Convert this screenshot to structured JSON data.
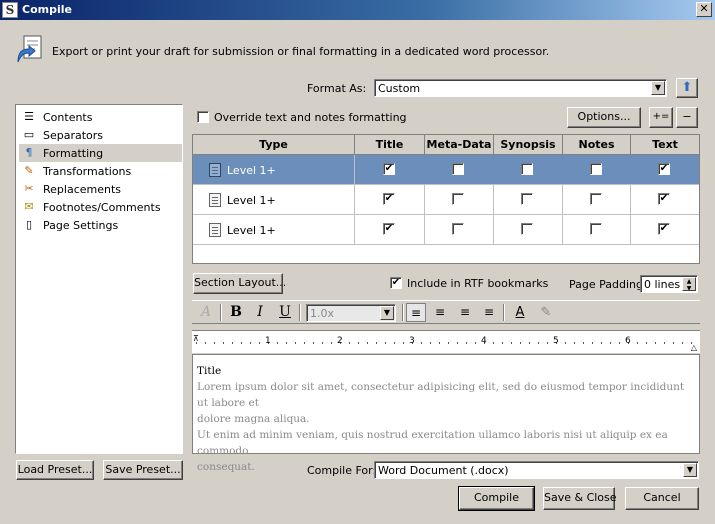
{
  "window": {
    "title": "Compile",
    "app_icon": "S"
  },
  "header": {
    "description": "Export or print your draft for submission or final formatting in a dedicated word processor."
  },
  "format_as": {
    "label": "Format As:",
    "value": "Custom"
  },
  "sidebar": {
    "items": [
      {
        "label": "Contents",
        "icon": "list-icon",
        "selected": false
      },
      {
        "label": "Separators",
        "icon": "separator-icon",
        "selected": false
      },
      {
        "label": "Formatting",
        "icon": "formatting-icon",
        "selected": true
      },
      {
        "label": "Transformations",
        "icon": "transform-icon",
        "selected": false
      },
      {
        "label": "Replacements",
        "icon": "replace-icon",
        "selected": false
      },
      {
        "label": "Footnotes/Comments",
        "icon": "footnote-icon",
        "selected": false
      },
      {
        "label": "Page Settings",
        "icon": "page-icon",
        "selected": false
      }
    ]
  },
  "formatting": {
    "override_label": "Override text and notes formatting",
    "override_checked": false,
    "options_label": "Options...",
    "add_label": "+=",
    "remove_label": "−",
    "columns": [
      "Type",
      "Title",
      "Meta-Data",
      "Synopsis",
      "Notes",
      "Text"
    ],
    "rows": [
      {
        "type": "Level 1+",
        "icon": "folder-icon",
        "selected": true,
        "title": true,
        "meta": false,
        "synopsis": false,
        "notes": false,
        "text": true
      },
      {
        "type": "Level 1+",
        "icon": "document-group-icon",
        "selected": false,
        "title": true,
        "meta": false,
        "synopsis": false,
        "notes": false,
        "text": true
      },
      {
        "type": "Level 1+",
        "icon": "document-icon",
        "selected": false,
        "title": true,
        "meta": false,
        "synopsis": false,
        "notes": false,
        "text": true
      }
    ],
    "section_layout_label": "Section Layout...",
    "rtf_bookmarks_label": "Include in RTF bookmarks",
    "rtf_bookmarks_checked": true,
    "page_padding_label": "Page Padding:",
    "page_padding_value": "0 lines",
    "line_spacing": "1.0x",
    "ruler_numbers": [
      "1",
      "2",
      "3",
      "4",
      "5",
      "6"
    ],
    "preview_title": "Title",
    "preview_body_1": "Lorem ipsum dolor sit amet, consectetur adipisicing elit, sed do eiusmod tempor incididunt ut labore et",
    "preview_body_2": "dolore magna aliqua.",
    "preview_body_3": "Ut enim ad minim veniam, quis nostrud exercitation ullamco laboris nisi ut aliquip ex ea commodo",
    "preview_body_4": "consequat."
  },
  "toolbar": {
    "font_icon": "A",
    "bold": "B",
    "italic": "I",
    "underline": "U"
  },
  "footer": {
    "load_preset": "Load Preset...",
    "save_preset": "Save Preset...",
    "compile_for_label": "Compile For:",
    "compile_for_value": "Word Document (.docx)",
    "compile": "Compile",
    "save_close": "Save & Close",
    "cancel": "Cancel"
  }
}
